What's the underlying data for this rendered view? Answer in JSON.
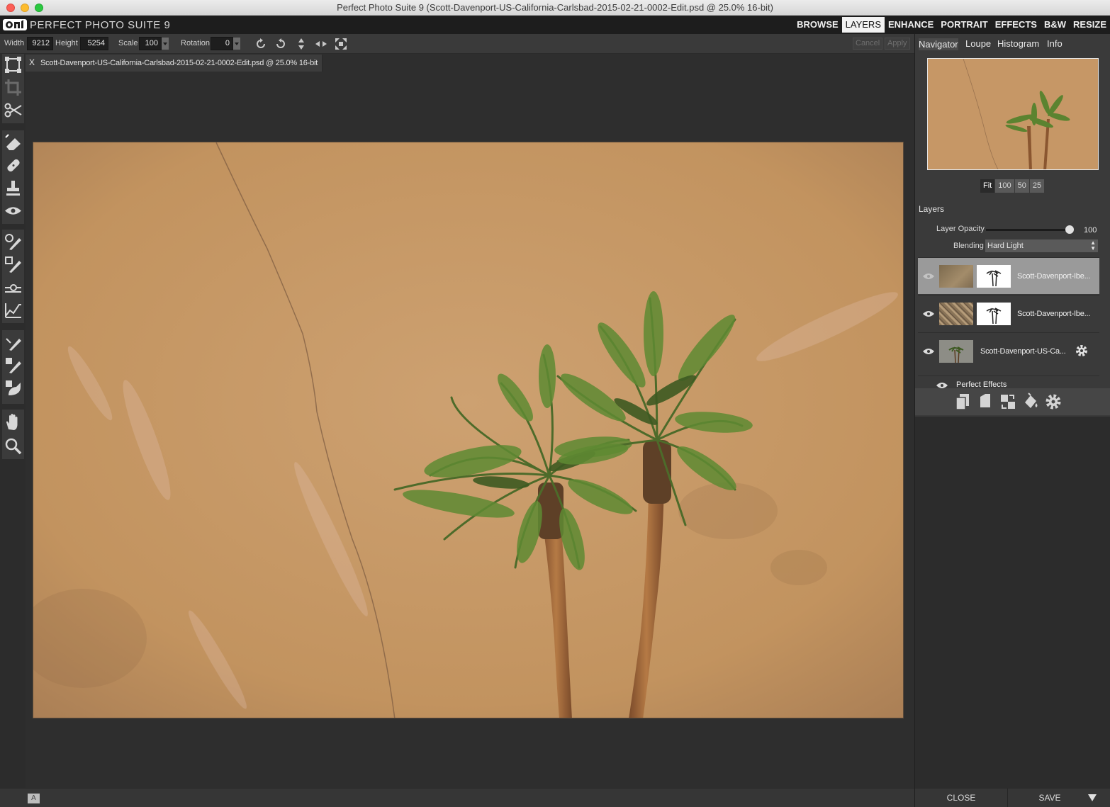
{
  "window": {
    "title": "Perfect Photo Suite 9 (Scott-Davenport-US-California-Carlsbad-2015-02-21-0002-Edit.psd @ 25.0% 16-bit)"
  },
  "app": {
    "name": "PERFECT PHOTO SUITE 9",
    "modules": [
      "BROWSE",
      "LAYERS",
      "ENHANCE",
      "PORTRAIT",
      "EFFECTS",
      "B&W",
      "RESIZE"
    ],
    "active_module": "LAYERS"
  },
  "toolbar": {
    "width_label": "Width",
    "width_value": "9212",
    "height_label": "Height",
    "height_value": "5254",
    "scale_label": "Scale",
    "scale_value": "100",
    "rotation_label": "Rotation",
    "rotation_value": "0",
    "cancel_label": "Cancel",
    "apply_label": "Apply"
  },
  "document": {
    "tab_close": "X",
    "tab_label": "Scott-Davenport-US-California-Carlsbad-2015-02-21-0002-Edit.psd @ 25.0% 16-bit"
  },
  "tools": [
    "transform",
    "crop",
    "cut",
    "eraser",
    "healing",
    "clone-stamp",
    "red-eye",
    "masking-brush",
    "masking-brush-invert",
    "masking-line",
    "masking-bug",
    "refine-brush",
    "chisel",
    "blur",
    "hand",
    "zoom"
  ],
  "status": {
    "badge": "A"
  },
  "panel": {
    "tabs": [
      "Navigator",
      "Loupe",
      "Histogram",
      "Info"
    ],
    "active_tab": "Navigator",
    "zoom_options": [
      "Fit",
      "100",
      "50",
      "25"
    ],
    "active_zoom": "Fit"
  },
  "layers": {
    "title": "Layers",
    "opacity_label": "Layer Opacity",
    "opacity_value": "100",
    "blending_label": "Blending",
    "blending_value": "Hard Light",
    "items": [
      {
        "name": "Scott-Davenport-Ibe...",
        "selected": true,
        "has_mask": true
      },
      {
        "name": "Scott-Davenport-Ibe...",
        "selected": false,
        "has_mask": true
      },
      {
        "name": "Scott-Davenport-US-Ca...",
        "selected": false,
        "has_mask": false
      }
    ],
    "effects_label": "Perfect Effects"
  },
  "footer": {
    "close_label": "CLOSE",
    "save_label": "SAVE"
  },
  "colors": {
    "photo_base": "#c69a6a",
    "selection": "#9a9a9a",
    "toolbar": "#3a3a3a"
  }
}
